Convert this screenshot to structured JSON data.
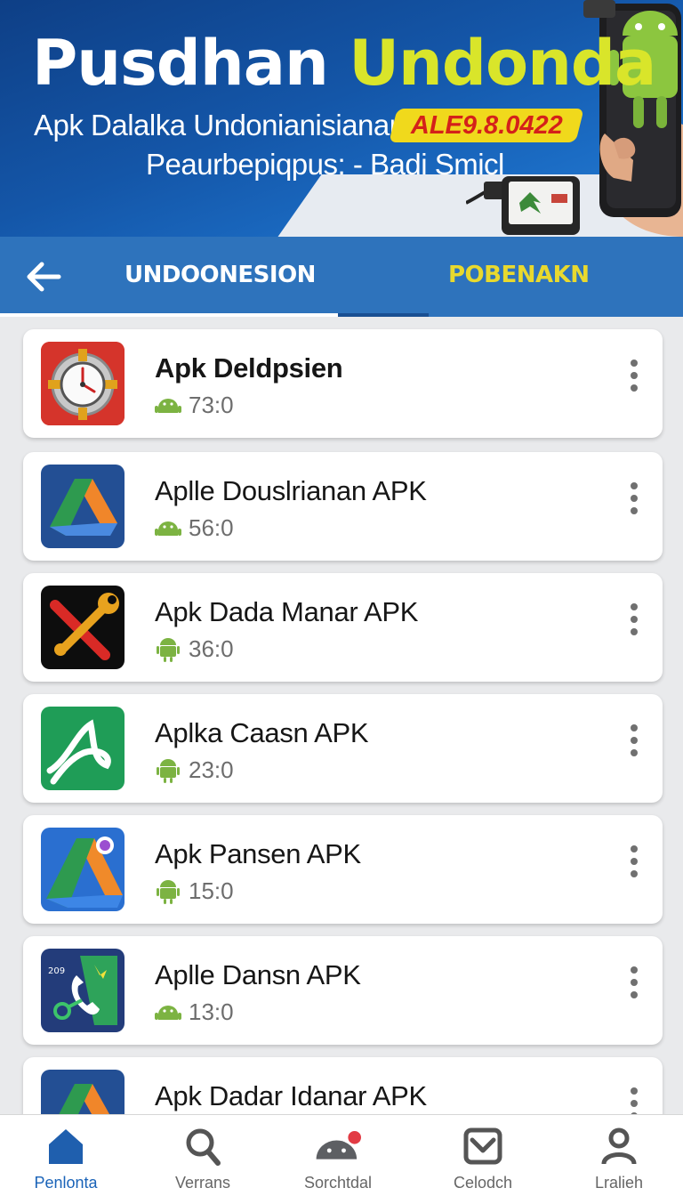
{
  "banner": {
    "title_part1": "Pusdhan",
    "title_part2": "Undonda",
    "subtitle": "Apk Dalalka Undonianisianar",
    "version": "ALE9.8.0422",
    "tagline": "Peaurbepiqpus: - Badi Smicl"
  },
  "tabs": {
    "left": "UNDOONESION",
    "right": "POBENAKN"
  },
  "apps": [
    {
      "name": "Apk Deldpsien",
      "count": "73:0",
      "bold": true,
      "icon": "gear-clock-icon",
      "meta_icon": "android-icon"
    },
    {
      "name": "Aplle Douslrianan APK",
      "count": "56:0",
      "bold": false,
      "icon": "drive-triangle-icon",
      "meta_icon": "android-icon"
    },
    {
      "name": "Apk Dada Manar APK",
      "count": "36:0",
      "bold": false,
      "icon": "tools-icon",
      "meta_icon": "android-icon"
    },
    {
      "name": "Aplka Caasn APK",
      "count": "23:0",
      "bold": false,
      "icon": "swirl-letter-icon",
      "meta_icon": "android-icon"
    },
    {
      "name": "Apk Pansen APK",
      "count": "15:0",
      "bold": false,
      "icon": "triangle-badge-icon",
      "meta_icon": "android-icon"
    },
    {
      "name": "Aplle Dansn APK",
      "count": "13:0",
      "bold": false,
      "icon": "phone-map-icon",
      "meta_icon": "android-icon"
    },
    {
      "name": "Apk Dadar Idanar APK",
      "count": "",
      "bold": false,
      "icon": "drive-triangle-icon",
      "meta_icon": "android-icon"
    }
  ],
  "nav": [
    {
      "label": "Penlonta",
      "icon": "home-icon",
      "active": true
    },
    {
      "label": "Verrans",
      "icon": "search-icon",
      "active": false
    },
    {
      "label": "Sorchtdal",
      "icon": "android-robot-icon",
      "active": false
    },
    {
      "label": "Celodch",
      "icon": "mail-icon",
      "active": false
    },
    {
      "label": "Lralieh",
      "icon": "profile-icon",
      "active": false
    }
  ],
  "colors": {
    "banner_blue": "#1456a8",
    "tabbar_blue": "#2e73bc",
    "accent_yellow": "#d9e52a",
    "badge_red": "#d4211a",
    "android_green": "#7cb342",
    "nav_active": "#1a63b8"
  }
}
